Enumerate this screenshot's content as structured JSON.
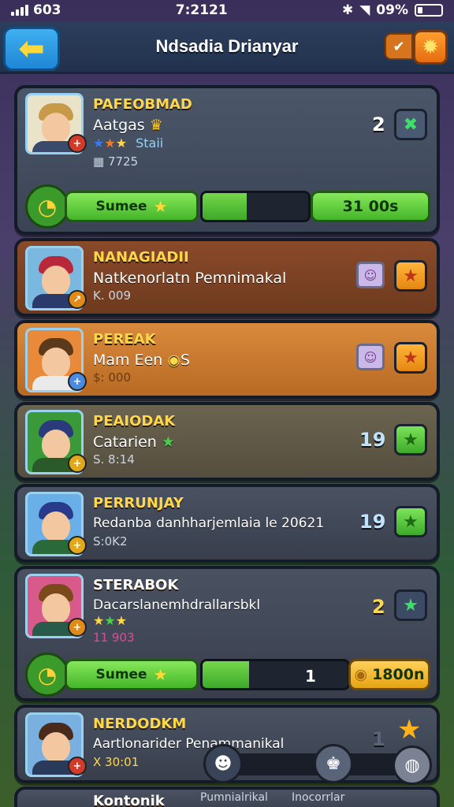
{
  "status": {
    "carrier": "603",
    "time": "7:2121",
    "battery": "09%"
  },
  "header": {
    "title": "Ndsadia Drianyar",
    "back_icon": "arrow-left-icon",
    "right_small": "✔",
    "right_big_icon": "gear-icon"
  },
  "cards": [
    {
      "name": "PAFEOBMAD",
      "subtitle": "Aatgas",
      "stars": "★★★",
      "stars_label": "Staii",
      "meta": "7725",
      "rank": "2",
      "action": "✖"
    },
    {
      "name": "NANAGIADII",
      "subtitle": "Natkenorlatn Pemnimakal",
      "meta": "K. 009",
      "action": "★"
    },
    {
      "name": "PEREAK",
      "subtitle": "Mam Een",
      "subtitle_extra": "S",
      "meta": "$: 000",
      "action": "★"
    },
    {
      "name": "PEAIODAK",
      "subtitle": "Catarien",
      "meta": "S. 8:14",
      "rank": "19",
      "action": "★"
    },
    {
      "name": "PERRUNJAY",
      "subtitle": "Redanba danhharjemlaia le 20621",
      "meta": "S:0K2",
      "rank": "19",
      "action": "★"
    },
    {
      "name": "STERABOK",
      "subtitle": "Dacarslanemhdrallarsbkl",
      "stars": "★★★",
      "meta": "11 903",
      "rank": "2",
      "action": "★"
    },
    {
      "name": "NERDODKM",
      "subtitle": "Aartlonarider Penammanikal",
      "meta": "X 30:01",
      "rank": "1"
    },
    {
      "name": "Kontonik"
    }
  ],
  "progress1": {
    "button": "Sumee",
    "end": "31 00s",
    "fill_fraction": 0.42
  },
  "progress2": {
    "button": "Sumee",
    "num": "1",
    "end": "1800n",
    "fill_fraction": 0.32
  },
  "bottom": {
    "label1": "Pumnialrikal",
    "label2": "Inocorrlar"
  }
}
